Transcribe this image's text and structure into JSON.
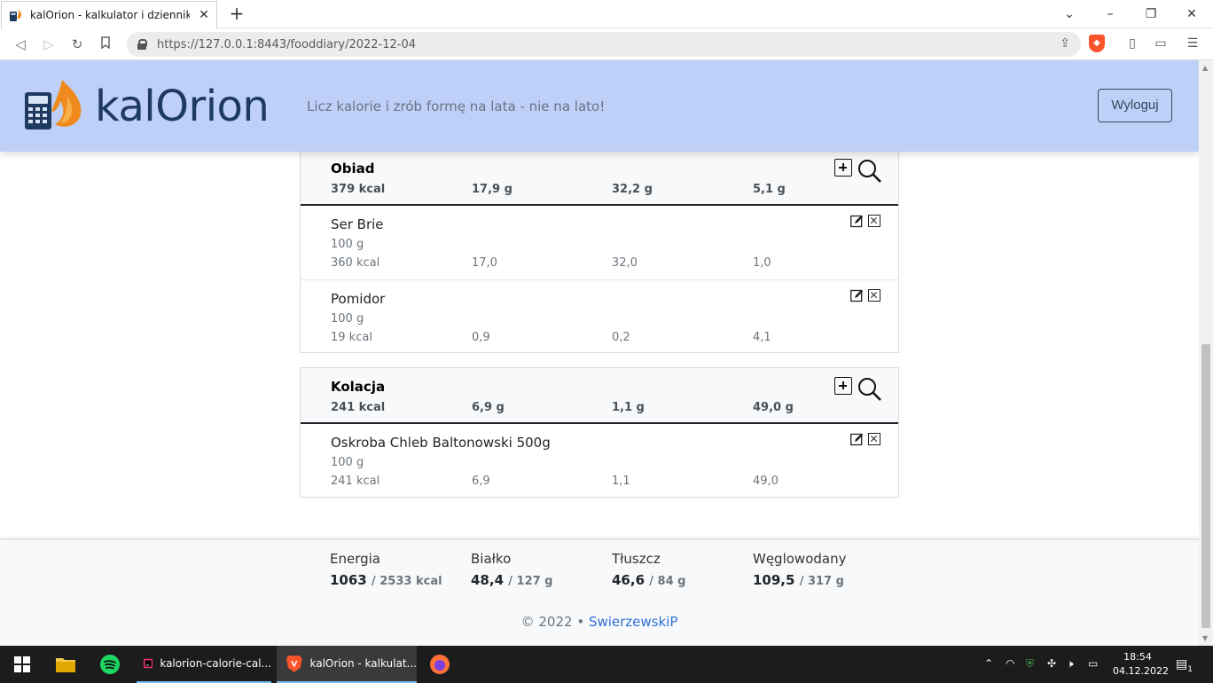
{
  "browser": {
    "tab_title": "kalOrion - kalkulator i dziennik ka",
    "url": "https://127.0.0.1:8443/fooddiary/2022-12-04"
  },
  "header": {
    "logo": "kalOrion",
    "tagline": "Licz kalorie i zrób formę na lata - nie na lato!",
    "logout_label": "Wyloguj"
  },
  "meals": [
    {
      "name": "Obiad",
      "totals": [
        "379 kcal",
        "17,9 g",
        "32,2 g",
        "5,1 g"
      ],
      "items": [
        {
          "name": "Ser Brie",
          "amount": "100 g",
          "values": [
            "360 kcal",
            "17,0",
            "32,0",
            "1,0"
          ]
        },
        {
          "name": "Pomidor",
          "amount": "100 g",
          "values": [
            "19 kcal",
            "0,9",
            "0,2",
            "4,1"
          ]
        }
      ]
    },
    {
      "name": "Kolacja",
      "totals": [
        "241 kcal",
        "6,9 g",
        "1,1 g",
        "49,0 g"
      ],
      "items": [
        {
          "name": "Oskroba Chleb Baltonowski 500g",
          "amount": "100 g",
          "values": [
            "241 kcal",
            "6,9",
            "1,1",
            "49,0"
          ]
        }
      ]
    }
  ],
  "summary": [
    {
      "label": "Energia",
      "value": "1063",
      "total": "/ 2533 kcal"
    },
    {
      "label": "Białko",
      "value": "48,4",
      "total": "/ 127 g"
    },
    {
      "label": "Tłuszcz",
      "value": "46,6",
      "total": "/ 84 g"
    },
    {
      "label": "Węglowodany",
      "value": "109,5",
      "total": "/ 317 g"
    }
  ],
  "footer": {
    "copyright": "© 2022 •",
    "author": "SwierzewskiP"
  },
  "taskbar": {
    "apps": [
      {
        "label": "kalorion-calorie-cal..."
      },
      {
        "label": "kalOrion - kalkulat..."
      }
    ],
    "time": "18:54",
    "date": "04.12.2022",
    "notifications": "1"
  },
  "colors": {
    "header_bg": "#bed0f7",
    "logo_text": "#1f3a5f",
    "link": "#2f6fd6",
    "brave": "#fb542b"
  }
}
